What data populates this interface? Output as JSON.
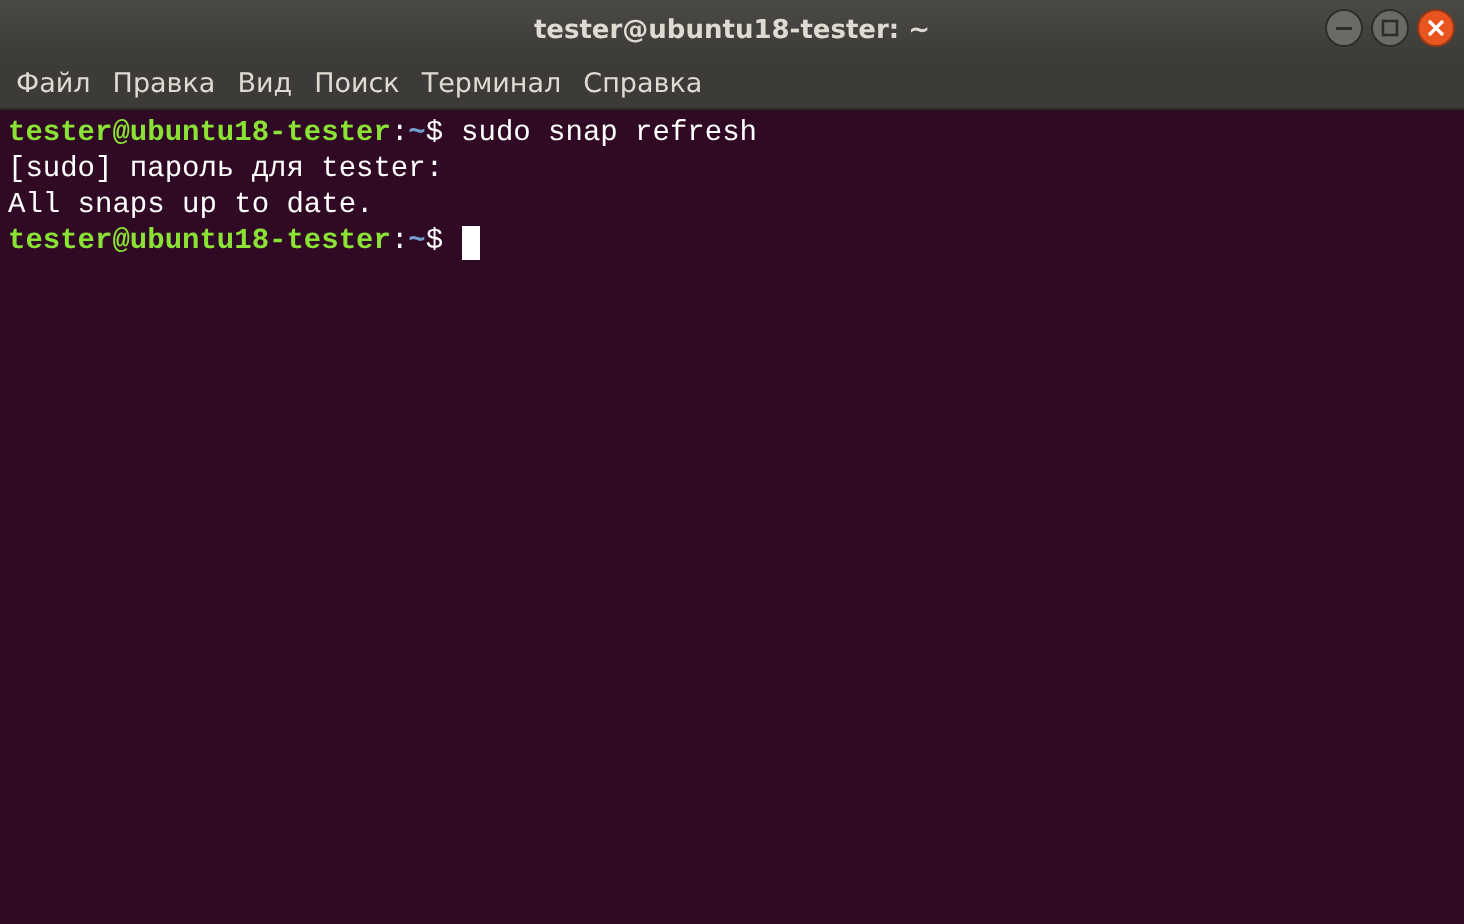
{
  "window": {
    "title": "tester@ubuntu18-tester: ~"
  },
  "menu": [
    "Файл",
    "Правка",
    "Вид",
    "Поиск",
    "Терминал",
    "Справка"
  ],
  "terminal": {
    "lines": [
      {
        "kind": "prompt",
        "user_host": "tester@ubuntu18-tester",
        "separator": ":",
        "path": "~",
        "symbol": "$",
        "command": "sudo snap refresh"
      },
      {
        "kind": "output",
        "text": "[sudo] пароль для tester:"
      },
      {
        "kind": "output",
        "text": "All snaps up to date."
      },
      {
        "kind": "prompt",
        "user_host": "tester@ubuntu18-tester",
        "separator": ":",
        "path": "~",
        "symbol": "$"
      }
    ],
    "cursor": true
  }
}
